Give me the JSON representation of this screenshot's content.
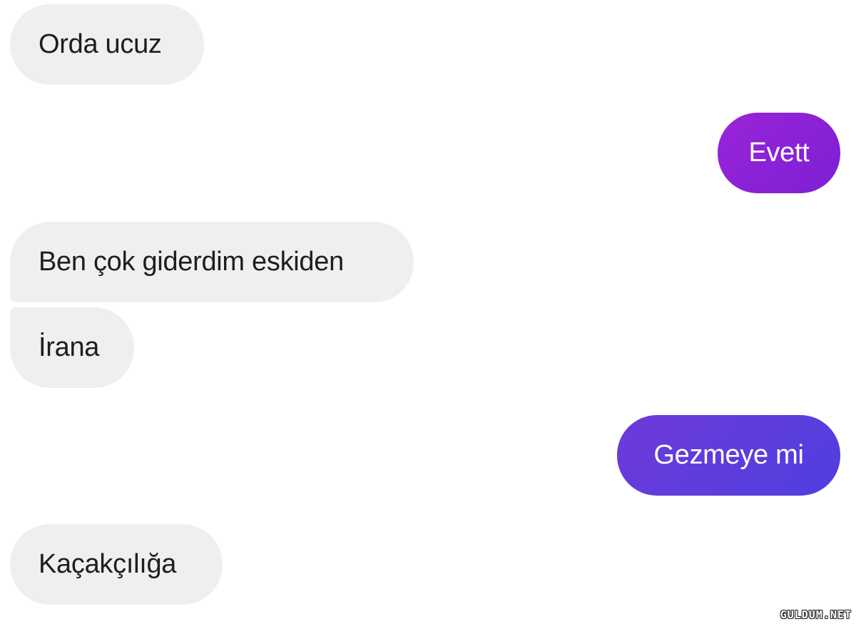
{
  "conversation": {
    "messages": [
      {
        "sender": "other",
        "text": "Orda ucuz"
      },
      {
        "sender": "self",
        "text": "Evett",
        "color": "#8a22d6"
      },
      {
        "sender": "other",
        "text": "Ben çok giderdim eskiden"
      },
      {
        "sender": "other",
        "text": "İrana"
      },
      {
        "sender": "self",
        "text": "Gezmeye mi",
        "color": "#5d3ddc"
      },
      {
        "sender": "other",
        "text": "Kaçakçılığa"
      }
    ]
  },
  "watermark": {
    "text": "GULDUM.NET"
  },
  "colors": {
    "incoming_bubble": "#efefef",
    "incoming_text": "#1e1e1e",
    "outgoing_text": "#ffffff",
    "background": "#ffffff"
  }
}
